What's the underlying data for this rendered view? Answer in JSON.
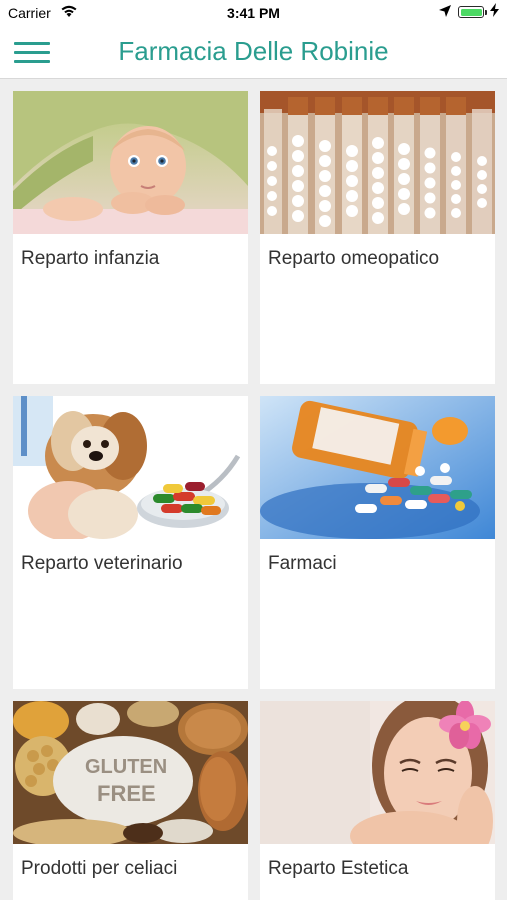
{
  "status_bar": {
    "carrier": "Carrier",
    "time": "3:41 PM",
    "battery_level": 1.0,
    "icons": [
      "wifi-icon",
      "location-arrow-icon",
      "battery-icon",
      "charging-bolt-icon"
    ]
  },
  "header": {
    "title": "Farmacia Delle Robinie",
    "menu_icon": "hamburger-menu-icon",
    "accent_color": "#2a9d8f"
  },
  "categories": [
    {
      "label": "Reparto infanzia",
      "image": "baby-under-blanket"
    },
    {
      "label": "Reparto omeopatico",
      "image": "homeopathic-vials"
    },
    {
      "label": "Reparto veterinario",
      "image": "dog-and-pills-spoon"
    },
    {
      "label": "Farmaci",
      "image": "pill-bottle-spilled"
    },
    {
      "label": "Prodotti per celiaci",
      "image": "gluten-free-bread"
    },
    {
      "label": "Reparto Estetica",
      "image": "woman-with-flower"
    }
  ]
}
